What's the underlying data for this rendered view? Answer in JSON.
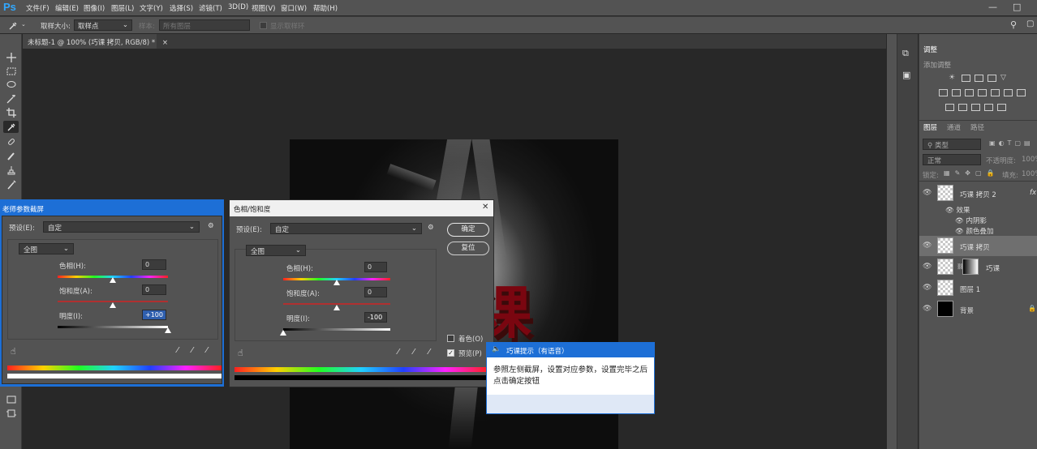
{
  "app": {
    "logo": "Ps"
  },
  "menu": [
    "文件(F)",
    "编辑(E)",
    "图像(I)",
    "图层(L)",
    "文字(Y)",
    "选择(S)",
    "滤镜(T)",
    "3D(D)",
    "视图(V)",
    "窗口(W)",
    "帮助(H)"
  ],
  "window_controls": {
    "minimize": "—",
    "maximize": "□"
  },
  "options": {
    "sample_size_label": "取样大小:",
    "sample_size_value": "取样点",
    "sample_label": "样本:",
    "sample_value": "所有图层",
    "show_ring_label": "显示取样环"
  },
  "document": {
    "tab_title": "未标题-1 @ 100% (巧课 拷贝, RGB/8) *",
    "close": "×",
    "canvas_text": "课"
  },
  "right_panel": {
    "adjust_tab": "调整",
    "add_adjust": "添加调整",
    "tabs": [
      "图层",
      "通道",
      "路径"
    ],
    "filter_kind": "类型",
    "blend_mode": "正常",
    "opacity_label": "不透明度:",
    "opacity_value": "100%",
    "lock_label": "锁定:",
    "fill_label": "填充:",
    "fill_value": "100%",
    "layers": [
      {
        "name": "巧课 拷贝 2",
        "fx": "fx"
      },
      {
        "name": "效果"
      },
      {
        "name": "内阴影"
      },
      {
        "name": "颜色叠加"
      },
      {
        "name": "巧课 拷贝"
      },
      {
        "name": "巧课"
      },
      {
        "name": "图层 1"
      },
      {
        "name": "背景"
      }
    ]
  },
  "ref_dialog": {
    "title": "老师参数截屏",
    "preset_label": "预设(E):",
    "preset_value": "自定",
    "channel_value": "全图",
    "hue_label": "色相(H):",
    "hue_value": "0",
    "sat_label": "饱和度(A):",
    "sat_value": "0",
    "light_label": "明度(I):",
    "light_value": "+100"
  },
  "hs_dialog": {
    "title": "色相/饱和度",
    "close": "✕",
    "preset_label": "预设(E):",
    "preset_value": "自定",
    "channel_value": "全图",
    "hue_label": "色相(H):",
    "hue_value": "0",
    "sat_label": "饱和度(A):",
    "sat_value": "0",
    "light_label": "明度(I):",
    "light_value": "-100",
    "ok_label": "确定",
    "reset_label": "复位",
    "colorize_label": "着色(O)",
    "colorize_checked": false,
    "preview_label": "预览(P)",
    "preview_checked": true,
    "hue_ratio": 0.5,
    "sat_ratio": 0.5,
    "light_ratio": 0.0,
    "ref_light_ratio": 1.0
  },
  "tip": {
    "title": "巧课提示（有语音）",
    "body": "参照左侧截屏，设置对应参数，设置完毕之后点击确定按钮"
  }
}
